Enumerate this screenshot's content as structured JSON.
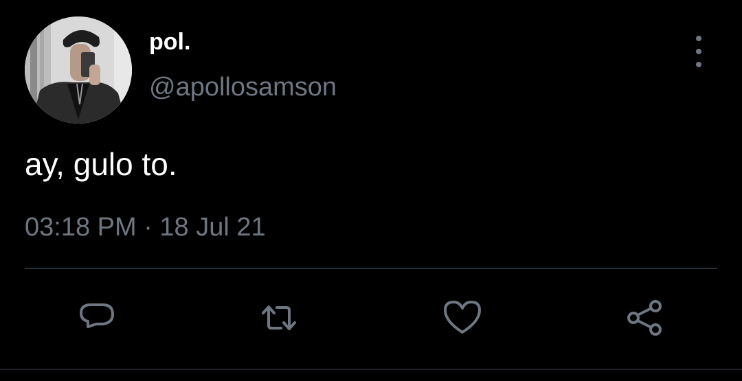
{
  "tweet": {
    "display_name": "pol.",
    "handle": "@apollosamson",
    "text": "ay, gulo to.",
    "timestamp": "03:18 PM · 18 Jul 21"
  },
  "icons": {
    "more": "more-vertical-icon",
    "reply": "reply-icon",
    "retweet": "retweet-icon",
    "like": "heart-icon",
    "share": "share-icon"
  },
  "colors": {
    "background": "#000000",
    "primary_text": "#ffffff",
    "secondary_text": "#6e7781",
    "divider": "#2a2f34"
  }
}
